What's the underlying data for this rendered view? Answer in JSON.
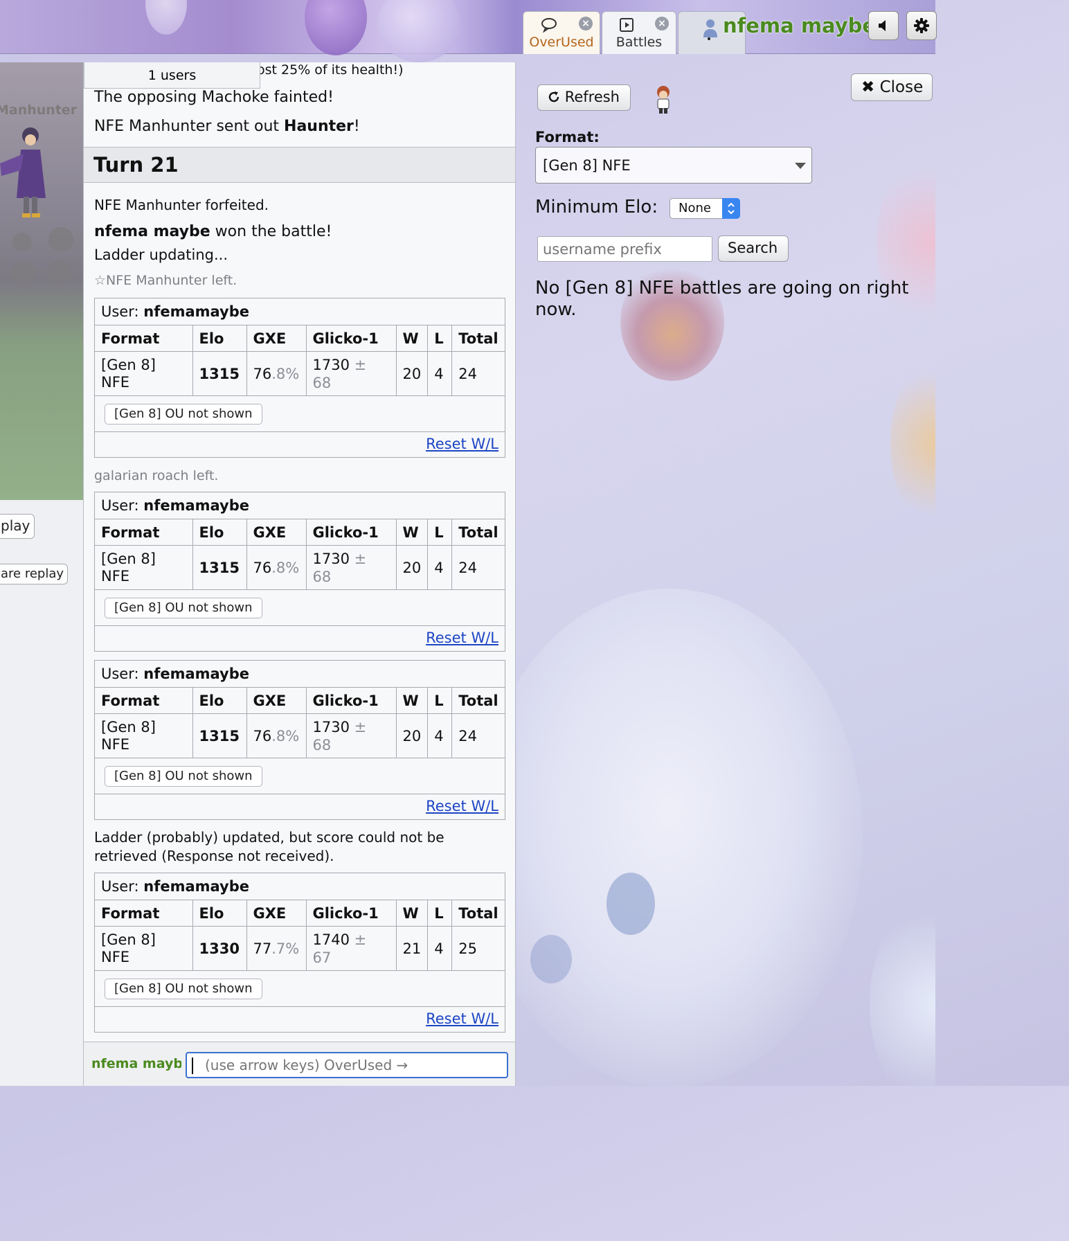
{
  "header": {
    "tabs": [
      {
        "label": "OverUsed",
        "icon": "chat-bubble-icon"
      },
      {
        "label": "Battles",
        "icon": "play-box-icon"
      }
    ],
    "username": "nfema maybe"
  },
  "battle": {
    "trainer_name": "Manhunter",
    "replay_button": "play",
    "share_button": "are replay"
  },
  "chat": {
    "users_badge": "1 users",
    "cut_message": "ost 25% of its health!)",
    "fainted": "The opposing Machoke fainted!",
    "sent_out_prefix": "NFE Manhunter sent out ",
    "sent_out_pokemon": "Haunter",
    "sent_out_suffix": "!",
    "turn": "Turn 21",
    "forfeited": "NFE Manhunter forfeited.",
    "winner": "nfema maybe",
    "won_text": " won the battle!",
    "ladder_updating": "Ladder updating...",
    "left_manhunter": "☆NFE Manhunter left.",
    "left_roach": "galarian roach left.",
    "ladder_error": "Ladder (probably) updated, but score could not be retrieved (Response not received).",
    "rank_tables": [
      {
        "user_label": "User:",
        "user": "nfemamaybe",
        "headers": [
          "Format",
          "Elo",
          "GXE",
          "Glicko-1",
          "W",
          "L",
          "Total"
        ],
        "format": "[Gen 8] NFE",
        "elo": "1315",
        "gxe_main": "76",
        "gxe_dec": ".8%",
        "glicko_main": "1730",
        "glicko_pm": "±",
        "glicko_dev": "68",
        "w": "20",
        "l": "4",
        "total": "24",
        "hidden_button": "[Gen 8] OU not shown",
        "reset": "Reset W/L"
      },
      {
        "user_label": "User:",
        "user": "nfemamaybe",
        "headers": [
          "Format",
          "Elo",
          "GXE",
          "Glicko-1",
          "W",
          "L",
          "Total"
        ],
        "format": "[Gen 8] NFE",
        "elo": "1315",
        "gxe_main": "76",
        "gxe_dec": ".8%",
        "glicko_main": "1730",
        "glicko_pm": "±",
        "glicko_dev": "68",
        "w": "20",
        "l": "4",
        "total": "24",
        "hidden_button": "[Gen 8] OU not shown",
        "reset": "Reset W/L"
      },
      {
        "user_label": "User:",
        "user": "nfemamaybe",
        "headers": [
          "Format",
          "Elo",
          "GXE",
          "Glicko-1",
          "W",
          "L",
          "Total"
        ],
        "format": "[Gen 8] NFE",
        "elo": "1315",
        "gxe_main": "76",
        "gxe_dec": ".8%",
        "glicko_main": "1730",
        "glicko_pm": "±",
        "glicko_dev": "68",
        "w": "20",
        "l": "4",
        "total": "24",
        "hidden_button": "[Gen 8] OU not shown",
        "reset": "Reset W/L"
      },
      {
        "user_label": "User:",
        "user": "nfemamaybe",
        "headers": [
          "Format",
          "Elo",
          "GXE",
          "Glicko-1",
          "W",
          "L",
          "Total"
        ],
        "format": "[Gen 8] NFE",
        "elo": "1330",
        "gxe_main": "77",
        "gxe_dec": ".7%",
        "glicko_main": "1740",
        "glicko_pm": "±",
        "glicko_dev": "67",
        "w": "21",
        "l": "4",
        "total": "25",
        "hidden_button": "[Gen 8] OU not shown",
        "reset": "Reset W/L"
      }
    ],
    "self_name": "nfema mayb",
    "input_placeholder": "(use arrow keys) OverUsed →"
  },
  "battles_panel": {
    "refresh": "Refresh",
    "close": "Close",
    "format_label": "Format:",
    "format_value": "[Gen 8] NFE",
    "min_elo_label": "Minimum Elo:",
    "min_elo_value": "None",
    "prefix_placeholder": "username prefix",
    "search": "Search",
    "no_battles": "No [Gen 8] NFE battles are going on right now."
  },
  "colors": {
    "username_green": "#4a8a1f",
    "overused_orange": "#b3651b",
    "link_blue": "#1d45c4",
    "input_focus": "#3b6fd2"
  }
}
